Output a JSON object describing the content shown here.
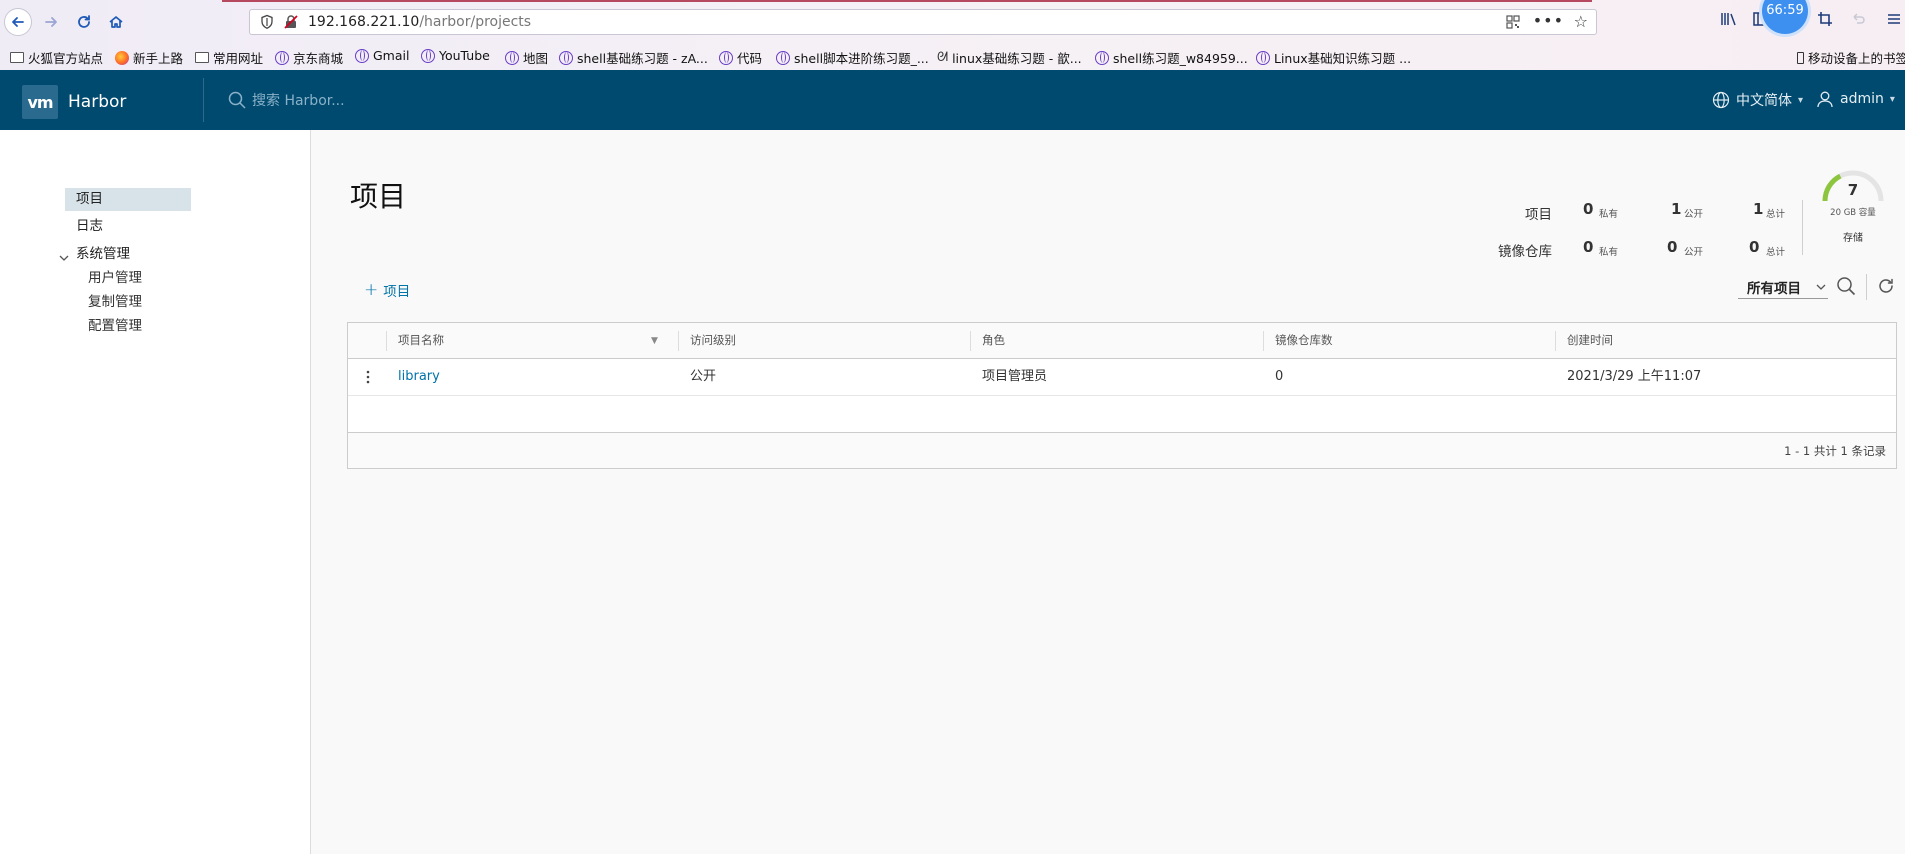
{
  "browser": {
    "url_host": "192.168.221.10",
    "url_path": "/harbor/projects",
    "timer": "66:59",
    "bookmarks": [
      {
        "label": "火狐官方站点",
        "icon": "folder-icon"
      },
      {
        "label": "新手上路",
        "icon": "firefox-icon"
      },
      {
        "label": "常用网址",
        "icon": "folder-icon"
      },
      {
        "label": "京东商城",
        "icon": "globe-icon"
      },
      {
        "label": "Gmail",
        "icon": "globe-icon"
      },
      {
        "label": "YouTube",
        "icon": "globe-icon"
      },
      {
        "label": "地图",
        "icon": "globe-icon"
      },
      {
        "label": "shell基础练习题 - zA...",
        "icon": "globe-icon"
      },
      {
        "label": "代码",
        "icon": "globe-icon"
      },
      {
        "label": "shell脚本进阶练习题_...",
        "icon": "globe-icon"
      },
      {
        "label": "linux基础练习题 - 歆...",
        "icon": "omega-icon"
      },
      {
        "label": "shell练习题_w84959...",
        "icon": "globe-icon"
      },
      {
        "label": "Linux基础知识练习题 ...",
        "icon": "globe-icon"
      }
    ],
    "mobile_bookmarks": "移动设备上的书签"
  },
  "header": {
    "brand_logo": "vm",
    "brand": "Harbor",
    "search_placeholder": "搜索 Harbor...",
    "language": "中文简体",
    "user": "admin"
  },
  "sidebar": {
    "items": [
      {
        "label": "项目",
        "active": true
      },
      {
        "label": "日志",
        "active": false
      },
      {
        "label": "系统管理",
        "active": false
      }
    ],
    "sub_items": [
      {
        "label": "用户管理"
      },
      {
        "label": "复制管理"
      },
      {
        "label": "配置管理"
      }
    ]
  },
  "main": {
    "title": "项目",
    "stats": {
      "projects_label": "项目",
      "repos_label": "镜像仓库",
      "projects": {
        "private": "0",
        "public": "1",
        "total": "1"
      },
      "repos": {
        "private": "0",
        "public": "0",
        "total": "0"
      },
      "units": {
        "private": "私有",
        "public": "公开",
        "total": "总计"
      }
    },
    "storage": {
      "value": "7",
      "capacity": "20 GB 容量",
      "label": "存储",
      "used_fraction": 0.35
    },
    "add_button": "项目",
    "filter": {
      "selected": "所有项目"
    },
    "table": {
      "columns": [
        "项目名称",
        "访问级别",
        "角色",
        "镜像仓库数",
        "创建时间"
      ],
      "rows": [
        {
          "name": "library",
          "access": "公开",
          "role": "项目管理员",
          "repo_count": "0",
          "created": "2021/3/29 上午11:07"
        }
      ],
      "footer": "1 - 1 共计 1 条记录"
    }
  },
  "colors": {
    "header_bg": "#004a70",
    "link": "#0073a8",
    "active_nav": "#d8e3e9",
    "gauge": "#8cc63f"
  }
}
